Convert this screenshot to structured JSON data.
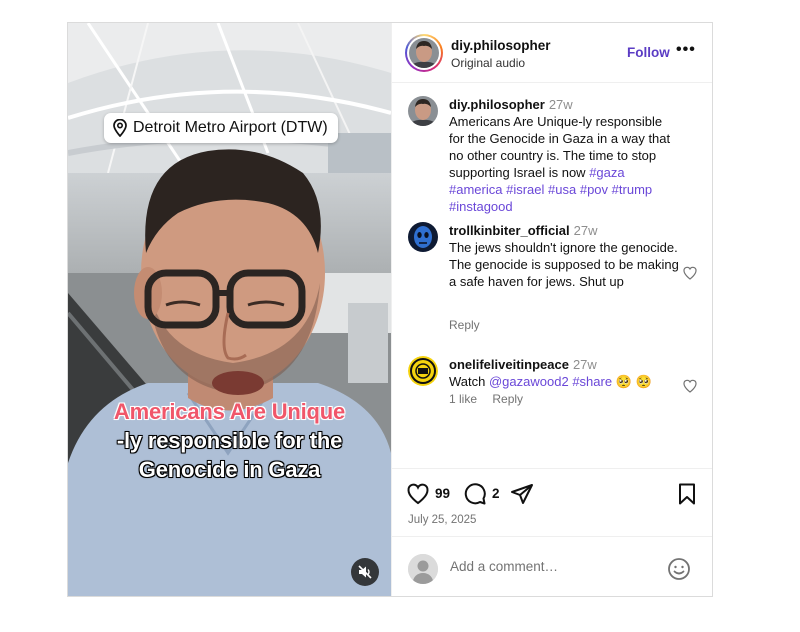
{
  "video": {
    "location": "Detroit Metro Airport (DTW)",
    "caption_line1": "Americans Are Unique",
    "caption_line2": "-ly responsible for the",
    "caption_line3": "Genocide in Gaza",
    "mute_icon": "speaker-muted-icon"
  },
  "header": {
    "username": "diy.philosopher",
    "subtitle": "Original audio",
    "follow_label": "Follow",
    "more_label": "•••"
  },
  "post": {
    "username": "diy.philosopher",
    "time": "27w",
    "text": "Americans Are Unique-ly responsible for the Genocide in Gaza in a way that no other country is. The time to stop supporting Israel is now",
    "hashtags": [
      "#gaza",
      "#america",
      "#israel",
      "#usa",
      "#pov",
      "#trump",
      "#instagood"
    ]
  },
  "comments": [
    {
      "username": "trollkinbiter_official",
      "time": "27w",
      "text": "The jews shouldn't ignore the genocide. The genocide is supposed to be making a safe haven for jews. Shut up",
      "reply_label": "Reply"
    },
    {
      "username": "onelifeliveitinpeace",
      "time": "27w",
      "text_prefix": "Watch ",
      "mention": "@gazawood2",
      "hashtag": "#share",
      "emojis": "🥺 🥺",
      "likes_label": "1 like",
      "reply_label": "Reply"
    }
  ],
  "actions": {
    "likes": "99",
    "comments": "2",
    "date": "July 25, 2025"
  },
  "add_comment": {
    "placeholder": "Add a comment…",
    "value": ""
  },
  "colors": {
    "accent": "#5b3cc4",
    "hashtag": "#6a47d8",
    "caption_red": "#f0566a"
  }
}
